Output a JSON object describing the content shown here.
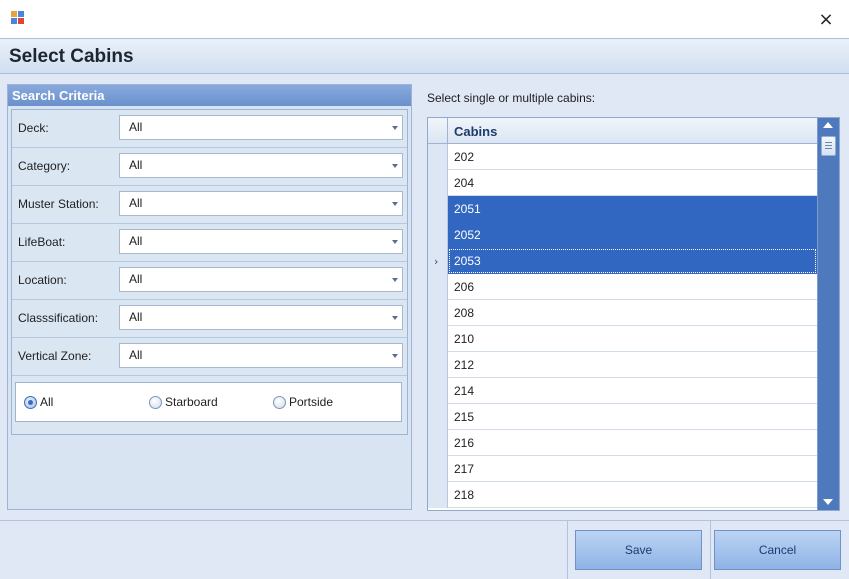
{
  "window": {
    "close_glyph": "×"
  },
  "header": {
    "title": "Select Cabins"
  },
  "search_criteria": {
    "title": "Search Criteria",
    "fields": [
      {
        "label": "Deck:",
        "value": "All"
      },
      {
        "label": "Category:",
        "value": "All"
      },
      {
        "label": "Muster Station:",
        "value": "All"
      },
      {
        "label": "LifeBoat:",
        "value": "All"
      },
      {
        "label": "Location:",
        "value": "All"
      },
      {
        "label": "Classsification:",
        "value": "All"
      },
      {
        "label": "Vertical Zone:",
        "value": "All"
      }
    ],
    "side_options": [
      {
        "label": "All",
        "checked": true
      },
      {
        "label": "Starboard",
        "checked": false
      },
      {
        "label": "Portside",
        "checked": false
      }
    ]
  },
  "cabins": {
    "instruction": "Select single or multiple cabins:",
    "column_header": "Cabins",
    "rows": [
      {
        "value": "202",
        "selected": false
      },
      {
        "value": "204",
        "selected": false
      },
      {
        "value": "2051",
        "selected": true
      },
      {
        "value": "2052",
        "selected": true
      },
      {
        "value": "2053",
        "selected": true,
        "current": true
      },
      {
        "value": "206",
        "selected": false
      },
      {
        "value": "208",
        "selected": false
      },
      {
        "value": "210",
        "selected": false
      },
      {
        "value": "212",
        "selected": false
      },
      {
        "value": "214",
        "selected": false
      },
      {
        "value": "215",
        "selected": false
      },
      {
        "value": "216",
        "selected": false
      },
      {
        "value": "217",
        "selected": false
      },
      {
        "value": "218",
        "selected": false
      }
    ]
  },
  "footer": {
    "save_label": "Save",
    "cancel_label": "Cancel"
  },
  "colors": {
    "selection": "#3167c0",
    "scrollbar": "#4e79bd",
    "group_header": "#6a90cc"
  }
}
